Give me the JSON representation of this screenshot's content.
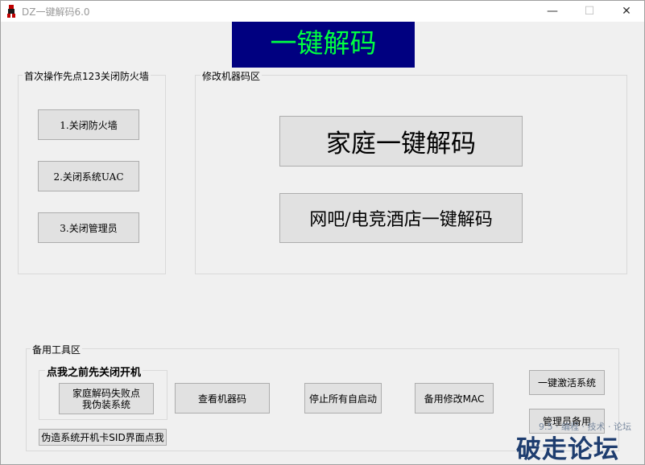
{
  "window": {
    "title": "DZ一键解码6.0",
    "minimize": "—",
    "maximize": "☐",
    "close": "✕"
  },
  "banner": {
    "text": "一键解码"
  },
  "group_firewall": {
    "label": "首次操作先点123关闭防火墙",
    "buttons": [
      "1.关闭防火墙",
      "2.关闭系统UAC",
      "3.关闭管理员"
    ]
  },
  "group_machine_code": {
    "label": "修改机器码区",
    "home_decode": "家庭一键解码",
    "netcafe_decode": "网吧/电竞酒店一键解码"
  },
  "group_tools": {
    "label": "备用工具区",
    "sub_label": "点我之前先关闭开机",
    "home_fail_line1": "家庭解码失败点",
    "home_fail_line2": "我伪装系统",
    "view_machine_code": "查看机器码",
    "stop_autostart": "停止所有自启动",
    "backup_mac": "备用修改MAC",
    "activate_system": "一键激活系统",
    "admin_backup": "管理员备用",
    "fake_sid": "伪造系统开机卡SID界面点我"
  },
  "watermark": {
    "text": "破走论坛",
    "sub": "9.5 · 编程 · 技术 · 论坛"
  },
  "colors": {
    "banner_bg": "#000080",
    "banner_text": "#00ff40"
  }
}
